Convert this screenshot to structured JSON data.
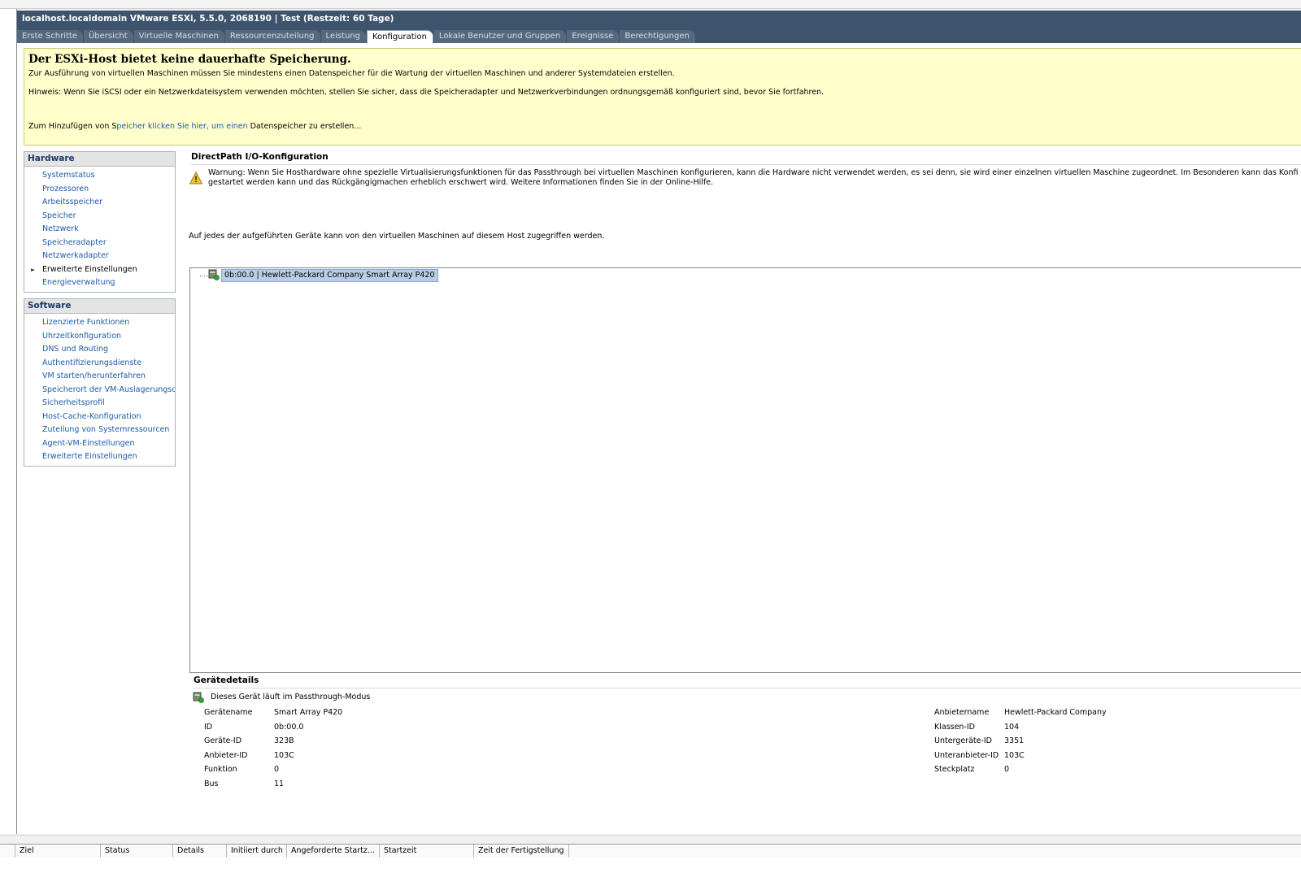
{
  "window": {
    "title": "localhost.localdomain VMware ESXi, 5.5.0, 2068190 | Test (Restzeit: 60 Tage)"
  },
  "tabs": [
    {
      "label": "Erste Schritte",
      "active": false
    },
    {
      "label": "Übersicht",
      "active": false
    },
    {
      "label": "Virtuelle Maschinen",
      "active": false
    },
    {
      "label": "Ressourcenzuteilung",
      "active": false
    },
    {
      "label": "Leistung",
      "active": false
    },
    {
      "label": "Konfiguration",
      "active": true
    },
    {
      "label": "Lokale Benutzer und Gruppen",
      "active": false
    },
    {
      "label": "Ereignisse",
      "active": false
    },
    {
      "label": "Berechtigungen",
      "active": false
    }
  ],
  "banner": {
    "title": "Der ESXi-Host bietet keine dauerhafte Speicherung.",
    "line1": "Zur Ausführung von virtuellen Maschinen müssen Sie mindestens einen Datenspeicher für die Wartung der virtuellen Maschinen und anderer Systemdateien erstellen.",
    "line2": "Hinweis: Wenn Sie iSCSI oder ein Netzwerkdateisystem verwenden möchten, stellen Sie sicher, dass die Speicheradapter und Netzwerkverbindungen ordnungsgemäß konfiguriert sind, bevor Sie fortfahren.",
    "add_prefix": "Zum Hinzufügen von S",
    "add_link": "peicher klicken Sie hier, um einen",
    "add_suffix": " Datenspeicher zu erstellen..."
  },
  "hardware": {
    "heading": "Hardware",
    "items": [
      {
        "label": "Systemstatus"
      },
      {
        "label": "Prozessoren"
      },
      {
        "label": "Arbeitsspeicher"
      },
      {
        "label": "Speicher"
      },
      {
        "label": "Netzwerk"
      },
      {
        "label": "Speicheradapter"
      },
      {
        "label": "Netzwerkadapter"
      },
      {
        "label": "Erweiterte Einstellungen"
      },
      {
        "label": "Energieverwaltung"
      }
    ]
  },
  "software": {
    "heading": "Software",
    "items": [
      {
        "label": "Lizenzierte Funktionen"
      },
      {
        "label": "Uhrzeitkonfiguration"
      },
      {
        "label": "DNS und Routing"
      },
      {
        "label": "Authentifizierungsdienste"
      },
      {
        "label": "VM starten/herunterfahren"
      },
      {
        "label": "Speicherort der VM-Auslagerungsdatei"
      },
      {
        "label": "Sicherheitsprofil"
      },
      {
        "label": "Host-Cache-Konfiguration"
      },
      {
        "label": "Zuteilung von Systemressourcen"
      },
      {
        "label": "Agent-VM-Einstellungen"
      },
      {
        "label": "Erweiterte Einstellungen"
      }
    ]
  },
  "directpath": {
    "title": "DirectPath I/O-Konfiguration",
    "warning": "Warnung: Wenn Sie Hosthardware ohne spezielle Virtualisierungsfunktionen für das Passthrough bei virtuellen Maschinen konfigurieren, kann die Hardware nicht verwendet werden, es sei denn, sie wird einer einzelnen virtuellen Maschine zugeordnet. Im Besonderen kann das Konfigurieren eines Geräts, das für den r",
    "warning2": "gestartet werden kann und das Rückgängigmachen erheblich erschwert wird. Weitere Informationen finden Sie in der Online-Hilfe.",
    "access_note": "Auf jedes der aufgeführten Geräte kann von den virtuellen Maschinen auf diesem Host zugegriffen werden.",
    "devices": [
      {
        "label": "0b:00.0 | Hewlett-Packard Company Smart Array P420"
      }
    ]
  },
  "details": {
    "title": "Gerätedetails",
    "passthrough": "Dieses Gerät läuft im Passthrough-Modus",
    "left": [
      {
        "label": "Gerätename",
        "value": "Smart Array P420"
      },
      {
        "label": "ID",
        "value": "0b:00.0"
      },
      {
        "label": "Geräte-ID",
        "value": "323B"
      },
      {
        "label": "Anbieter-ID",
        "value": "103C"
      },
      {
        "label": "Funktion",
        "value": "0"
      },
      {
        "label": "Bus",
        "value": "11"
      }
    ],
    "right": [
      {
        "label": "Anbietername",
        "value": "Hewlett-Packard Company"
      },
      {
        "label": "Klassen-ID",
        "value": "104"
      },
      {
        "label": "Untergeräte-ID",
        "value": "3351"
      },
      {
        "label": "Unteranbieter-ID",
        "value": "103C"
      },
      {
        "label": "Steckplatz",
        "value": "0"
      }
    ]
  },
  "tasks": {
    "columns": [
      {
        "label": "Ziel"
      },
      {
        "label": "Status"
      },
      {
        "label": "Details"
      },
      {
        "label": "Initiiert durch"
      },
      {
        "label": "Angeforderte Startz..."
      },
      {
        "label": "Startzeit"
      },
      {
        "label": "Zeit der Fertigstellung"
      }
    ]
  },
  "colors": {
    "header": "#3e546d",
    "banner": "#ffffcc",
    "link": "#1e5aa8",
    "selection": "#b9cde6"
  }
}
